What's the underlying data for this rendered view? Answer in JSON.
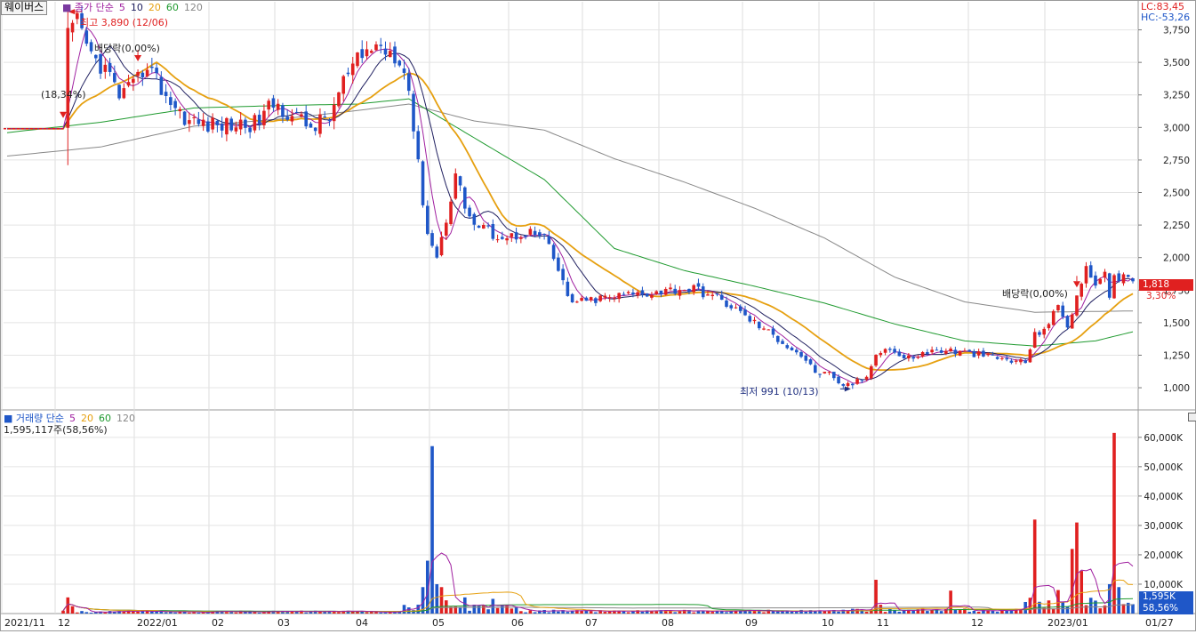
{
  "stock_name": "웨이버스",
  "price_legend": {
    "label": "종가 단순",
    "periods": [
      "5",
      "10",
      "20",
      "60",
      "120"
    ]
  },
  "volume_legend": {
    "label": "거래량 단순",
    "periods": [
      "5",
      "20",
      "60",
      "120"
    ]
  },
  "volume_info": "1,595,117주(58,56%)",
  "lc_label": "LC:83,45",
  "hc_label": "HC:-53,26",
  "current_price": "1,818",
  "current_change": "3,30%",
  "current_volume": "1,595K",
  "current_volume_pct": "58,56%",
  "annotations": {
    "high": "최고 3,890 (12/06)",
    "low": "최저 991 (10/13)",
    "dividend1": "배당락(0,00%)",
    "dividend2": "배당락(0,00%)",
    "split": "(18,34%)"
  },
  "colors": {
    "up": "#e02020",
    "down": "#1f57c8",
    "ma5": "#a020a0",
    "ma10": "#202060",
    "ma20": "#e6a010",
    "ma60": "#1f9a2f",
    "ma120": "#888888"
  },
  "chart_data": [
    {
      "type": "candlestick",
      "title": "웨이버스",
      "x_labels": [
        "2021/11",
        "12",
        "2022/01",
        "02",
        "03",
        "04",
        "05",
        "06",
        "07",
        "08",
        "09",
        "10",
        "11",
        "12",
        "2023/01",
        "01/27"
      ],
      "y_ticks": [
        1000,
        1250,
        1500,
        1750,
        2000,
        2250,
        2500,
        2750,
        3000,
        3250,
        3500,
        3750
      ],
      "y_tick_labels": [
        "1,000",
        "1,250",
        "1,500",
        "1,750",
        "2,000",
        "2,250",
        "2,500",
        "2,750",
        "3,000",
        "3,250",
        "3,500",
        "3,750"
      ],
      "ylim": [
        850,
        3870
      ],
      "anchors": [
        [
          0,
          2990
        ],
        [
          12,
          2990
        ],
        [
          13,
          3700
        ],
        [
          15,
          3800
        ],
        [
          18,
          3550
        ],
        [
          21,
          3450
        ],
        [
          24,
          3250
        ],
        [
          27,
          3300
        ],
        [
          30,
          3500
        ],
        [
          33,
          3300
        ],
        [
          36,
          3150
        ],
        [
          39,
          3050
        ],
        [
          43,
          3020
        ],
        [
          48,
          3020
        ],
        [
          53,
          3030
        ],
        [
          57,
          3180
        ],
        [
          61,
          3100
        ],
        [
          65,
          3000
        ],
        [
          69,
          3080
        ],
        [
          72,
          3350
        ],
        [
          75,
          3500
        ],
        [
          78,
          3620
        ],
        [
          81,
          3610
        ],
        [
          84,
          3550
        ],
        [
          86,
          3300
        ],
        [
          88,
          2700
        ],
        [
          90,
          2200
        ],
        [
          92,
          2000
        ],
        [
          94,
          2300
        ],
        [
          96,
          2650
        ],
        [
          98,
          2400
        ],
        [
          100,
          2250
        ],
        [
          103,
          2200
        ],
        [
          107,
          2150
        ],
        [
          111,
          2200
        ],
        [
          115,
          2150
        ],
        [
          118,
          1900
        ],
        [
          120,
          1700
        ],
        [
          122,
          1650
        ],
        [
          126,
          1680
        ],
        [
          130,
          1700
        ],
        [
          134,
          1720
        ],
        [
          139,
          1740
        ],
        [
          144,
          1760
        ],
        [
          147,
          1760
        ],
        [
          150,
          1720
        ],
        [
          154,
          1650
        ],
        [
          158,
          1550
        ],
        [
          162,
          1450
        ],
        [
          166,
          1350
        ],
        [
          170,
          1250
        ],
        [
          173,
          1120
        ],
        [
          176,
          1100
        ],
        [
          178,
          1020
        ],
        [
          181,
          1030
        ],
        [
          184,
          1080
        ],
        [
          186,
          1280
        ],
        [
          189,
          1300
        ],
        [
          192,
          1220
        ],
        [
          195,
          1250
        ],
        [
          198,
          1280
        ],
        [
          201,
          1290
        ],
        [
          204,
          1270
        ],
        [
          207,
          1260
        ],
        [
          210,
          1240
        ],
        [
          213,
          1220
        ],
        [
          216,
          1200
        ],
        [
          218,
          1200
        ],
        [
          220,
          1400
        ],
        [
          223,
          1500
        ],
        [
          225,
          1620
        ],
        [
          227,
          1480
        ],
        [
          229,
          1700
        ],
        [
          231,
          1900
        ],
        [
          233,
          1820
        ],
        [
          235,
          1850
        ],
        [
          236,
          1700
        ],
        [
          237,
          1880
        ],
        [
          239,
          1840
        ],
        [
          241,
          1818
        ]
      ],
      "ma120_anchors": [
        [
          0,
          2780
        ],
        [
          20,
          2850
        ],
        [
          40,
          3010
        ],
        [
          60,
          3070
        ],
        [
          75,
          3130
        ],
        [
          86,
          3180
        ],
        [
          100,
          3050
        ],
        [
          115,
          2980
        ],
        [
          130,
          2760
        ],
        [
          145,
          2580
        ],
        [
          160,
          2380
        ],
        [
          175,
          2150
        ],
        [
          190,
          1850
        ],
        [
          205,
          1660
        ],
        [
          220,
          1580
        ],
        [
          241,
          1590
        ]
      ],
      "ma60_anchors": [
        [
          0,
          2960
        ],
        [
          20,
          3040
        ],
        [
          40,
          3150
        ],
        [
          60,
          3170
        ],
        [
          75,
          3180
        ],
        [
          86,
          3220
        ],
        [
          100,
          2920
        ],
        [
          115,
          2600
        ],
        [
          130,
          2070
        ],
        [
          145,
          1900
        ],
        [
          160,
          1780
        ],
        [
          175,
          1650
        ],
        [
          190,
          1490
        ],
        [
          205,
          1360
        ],
        [
          220,
          1320
        ],
        [
          233,
          1360
        ],
        [
          241,
          1430
        ]
      ],
      "dividend_bars": [
        28,
        229
      ],
      "high_bar": 13,
      "low_bar": 181
    },
    {
      "type": "bar",
      "title": "거래량",
      "y_ticks": [
        10000,
        20000,
        30000,
        40000,
        50000,
        60000
      ],
      "y_tick_labels": [
        "10,000K",
        "20,000K",
        "30,000K",
        "40,000K",
        "50,000K",
        "60,000K"
      ],
      "ylim": [
        0,
        66000
      ],
      "spikes": [
        [
          13,
          5500
        ],
        [
          14,
          2500
        ],
        [
          88,
          3000
        ],
        [
          89,
          9000
        ],
        [
          90,
          18000
        ],
        [
          91,
          57000
        ],
        [
          92,
          10000
        ],
        [
          93,
          9000
        ],
        [
          94,
          4500
        ],
        [
          98,
          5500
        ],
        [
          100,
          3000
        ],
        [
          104,
          5000
        ],
        [
          186,
          11500
        ],
        [
          187,
          3000
        ],
        [
          202,
          7800
        ],
        [
          220,
          32000
        ],
        [
          225,
          8000
        ],
        [
          228,
          22000
        ],
        [
          229,
          31000
        ],
        [
          230,
          14500
        ],
        [
          236,
          10000
        ],
        [
          237,
          61500
        ],
        [
          238,
          9000
        ]
      ]
    }
  ]
}
